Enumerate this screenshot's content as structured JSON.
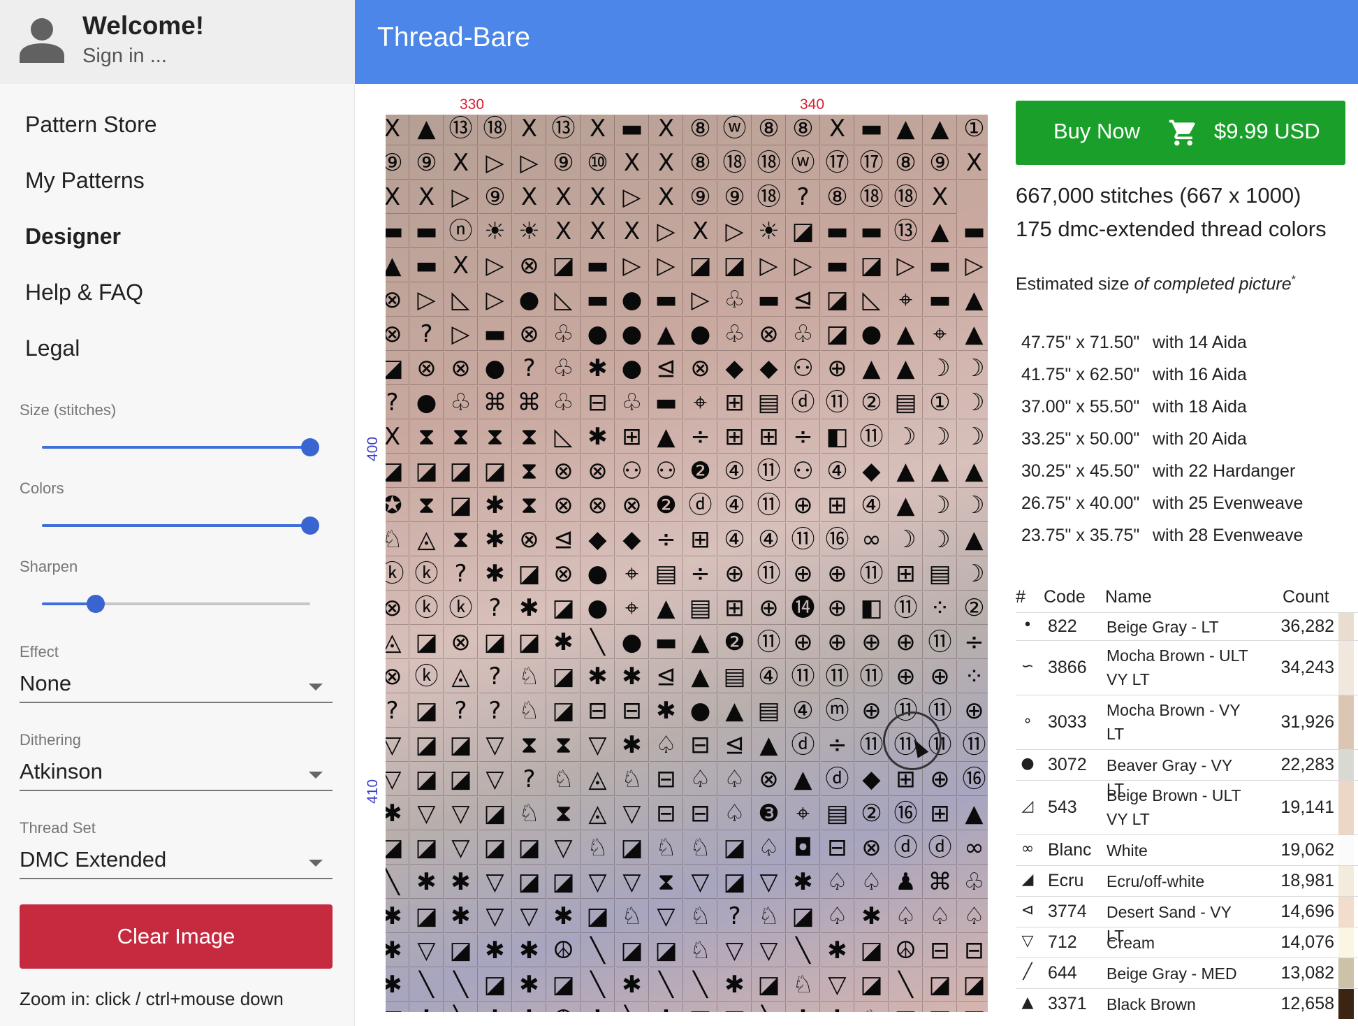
{
  "user": {
    "welcome": "Welcome!",
    "signin": "Sign in ..."
  },
  "app": {
    "title": "Thread-Bare"
  },
  "nav": [
    {
      "label": "Pattern Store",
      "active": false
    },
    {
      "label": "My Patterns",
      "active": false
    },
    {
      "label": "Designer",
      "active": true
    },
    {
      "label": "Help & FAQ",
      "active": false
    },
    {
      "label": "Legal",
      "active": false
    }
  ],
  "controls": {
    "size_label": "Size (stitches)",
    "size_value": 1.0,
    "colors_label": "Colors",
    "colors_value": 1.0,
    "sharpen_label": "Sharpen",
    "sharpen_value": 0.2,
    "effect_label": "Effect",
    "effect_value": "None",
    "dithering_label": "Dithering",
    "dithering_value": "Atkinson",
    "threadset_label": "Thread Set",
    "threadset_value": "DMC Extended",
    "clear_label": "Clear Image",
    "zoom_hint": "Zoom in: click / ctrl+mouse down"
  },
  "pattern": {
    "col_labels": [
      "330",
      "340"
    ],
    "row_labels": [
      "400",
      "410"
    ],
    "rows": [
      "X▲⑬⑱X⑬X▬X⑧ⓦ⑧⑧X▬▲▲①",
      "⑨⑨X▷▷⑨⑩XX⑧⑱⑱ⓦ⑰⑰⑧⑨X",
      "XX▷⑨XXX▷X⑨⑨⑱?⑧⑱⑱X",
      "▬▬ⓝ☀☀XXX▷X▷☀◪▬▬⑬▲▬",
      "▲▬X▷⊗◪▬▷▷◪◪▷▷▬◪▷▬▷",
      "⊗▷◺▷●◺▬●▬▷♧▬⊴◪◺⌖▬▲",
      "⊗?▷▬⊗♧●●▲●♧⊗♧◪●▲⌖▲",
      "◪⊗⊗●?♧✱●⊴⊗◆◆⚇⊕▲▲☽☽",
      "?●♧⌘⌘♧⊟♧▬⌖⊞▤ⓓ⑪②▤①☽",
      "X⧗⧗⧗⧗◺✱⊞▲÷⊞⊞÷◧⑪☽☽☽",
      "◪◪◪◪⧗⊗⊗⚇⚇❷④⑪⚇④◆▲▲▲",
      "✪⧗◪✱⧗⊗⊗⊗❷ⓓ④⑪⊕⊞④▲☽☽",
      "♘◬⧗✱⊗⊴◆◆÷⊞④④⑪⑯∞☽☽▲",
      "ⓚⓚ?✱◪⊗●⌖▤÷⊕⑪⊕⊕⑪⊞▤☽",
      "⊗ⓚⓚ?✱◪●⌖▲▤⊞⊕⓮⊕◧⑪⁘②",
      "◬◪⊗◪◪✱╲●▬▲❷⑪⊕⊕⊕⊕⑪÷",
      "⊗ⓚ◬?♘◪✱✱⊴▲▤④⑪⑪⑪⊕⊕⁘",
      "?◪??♘◪⊟⊟✱●▲▤④ⓜ⊕⑪⑪⊕",
      "▽◪◪▽⧗⧗▽✱♤⊟⊴▲ⓓ÷⑪⑪⑪⑪",
      "▽◪◪▽?♘◬♘⊟♤♤⊗▲ⓓ◆⊞⊕⑯",
      "✱▽▽◪♘⧗◬▽⊟⊟♤❸⌖▤②⑯⊞▲",
      "◪◪▽◪◪▽♘◪♘♘◪♤◘⊟⊗ⓓⓓ∞",
      "╲✱✱▽◪◪▽▽⧗▽◪▽✱♤♤♟⌘♧",
      "✱◪✱▽▽✱◪♘▽♘?♘◪♤✱♤♤♤",
      "✱▽◪✱✱☮╲◪◪♘▽▽╲✱◪☮⊟⊟",
      "✱╲╲◪✱◪╲✱╲╲✱◪♘▽◪╲◪◪⊟",
      "▽✱╲✱✱☮✱╲✱▽▽╲✱✱♘▽◪◪"
    ]
  },
  "purchase": {
    "buy_label": "Buy Now",
    "price": "$9.99 USD"
  },
  "summary": {
    "stitches": "667,000 stitches (667 x 1000)",
    "threads": "175 dmc-extended thread colors",
    "est_prefix": "Estimated size ",
    "est_em": "of completed picture",
    "est_sup": "*"
  },
  "sizes": [
    {
      "dim": "47.75\" x 71.50\"",
      "fabric": "with 14 Aida"
    },
    {
      "dim": "41.75\" x 62.50\"",
      "fabric": "with 16 Aida"
    },
    {
      "dim": "37.00\" x 55.50\"",
      "fabric": "with 18 Aida"
    },
    {
      "dim": "33.25\" x 50.00\"",
      "fabric": "with 20 Aida"
    },
    {
      "dim": "30.25\" x 45.50\"",
      "fabric": "with 22 Hardanger"
    },
    {
      "dim": "26.75\" x 40.00\"",
      "fabric": "with 25 Evenweave"
    },
    {
      "dim": "23.75\" x 35.75\"",
      "fabric": "with 28 Evenweave"
    }
  ],
  "table": {
    "headers": {
      "num": "#",
      "code": "Code",
      "name": "Name",
      "count": "Count"
    },
    "rows": [
      {
        "sym": "•",
        "code": "822",
        "name": "Beige Gray - LT",
        "count": "36,282",
        "color": "#e9ddcf"
      },
      {
        "sym": "∽",
        "code": "3866",
        "name": "Mocha Brown - ULT VY LT",
        "count": "34,243",
        "color": "#f0e8dc"
      },
      {
        "sym": "∘",
        "code": "3033",
        "name": "Mocha Brown - VY LT",
        "count": "31,926",
        "color": "#dbc6b4"
      },
      {
        "sym": "●",
        "code": "3072",
        "name": "Beaver Gray - VY LT",
        "count": "22,283",
        "color": "#d7d9d2"
      },
      {
        "sym": "◿",
        "code": "543",
        "name": "Beige Brown - ULT VY LT",
        "count": "19,141",
        "color": "#ecd6c6"
      },
      {
        "sym": "∞",
        "code": "Blanc",
        "name": "White",
        "count": "19,062",
        "color": "#fbfbfb"
      },
      {
        "sym": "◢",
        "code": "Ecru",
        "name": "Ecru/off-white",
        "count": "18,981",
        "color": "#f3ecdc"
      },
      {
        "sym": "⊲",
        "code": "3774",
        "name": "Desert Sand - VY LT",
        "count": "14,696",
        "color": "#f2dccb"
      },
      {
        "sym": "▽",
        "code": "712",
        "name": "Cream",
        "count": "14,076",
        "color": "#fbf5e3"
      },
      {
        "sym": "╱",
        "code": "644",
        "name": "Beige Gray - MED",
        "count": "13,082",
        "color": "#cbc2a8"
      },
      {
        "sym": "▲",
        "code": "3371",
        "name": "Black Brown",
        "count": "12,658",
        "color": "#3b2412"
      }
    ]
  }
}
